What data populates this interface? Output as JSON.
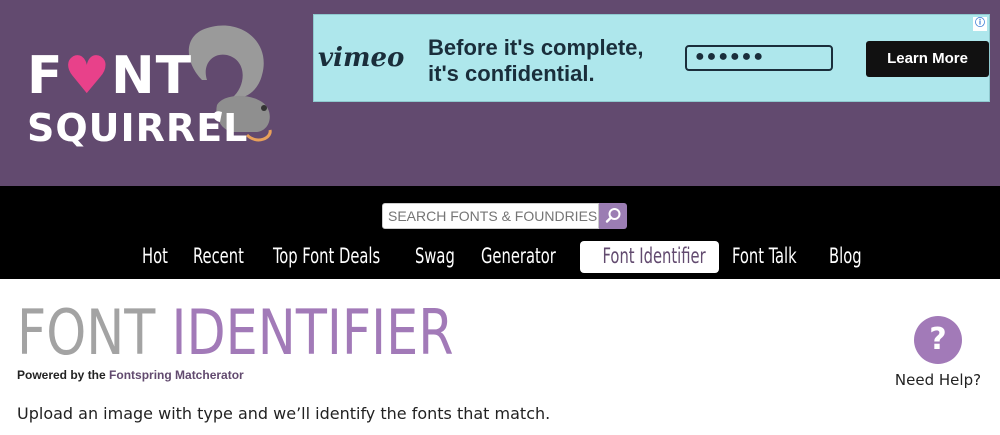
{
  "logo": {
    "line1_part1": "F",
    "line1_heart": "♥",
    "line1_part2": "NT",
    "line2": "SQUIRREL",
    "icon": "squirrel-mascot-icon"
  },
  "ad": {
    "brand": "vimeo",
    "headline": "Before it's complete, it's confidential.",
    "password_mask": "●●●●●●",
    "cta": "Learn More",
    "badge": "ⓘ"
  },
  "search": {
    "placeholder": "SEARCH FONTS & FOUNDRIES",
    "icon": "search-icon"
  },
  "nav": {
    "items": [
      {
        "label": "Hot"
      },
      {
        "label": "Recent"
      },
      {
        "label": "Top Font Deals"
      },
      {
        "label": "Swag"
      },
      {
        "label": "Generator"
      },
      {
        "label": "Font Identifier"
      },
      {
        "label": "Font Talk"
      },
      {
        "label": "Blog"
      }
    ],
    "active": "Font Identifier"
  },
  "main": {
    "title_part1": "FONT",
    "title_part2": "IDENTIFIER",
    "powered_prefix": "Powered by the",
    "powered_link": "Fontspring Matcherator",
    "intro": "Upload an image with type and we’ll identify the fonts that match."
  },
  "help": {
    "symbol": "?",
    "label": "Need Help?"
  },
  "colors": {
    "header_bg": "#624a6f",
    "accent": "#a27ab8",
    "ad_bg": "#aee7ec",
    "nav_bg": "#000000"
  }
}
